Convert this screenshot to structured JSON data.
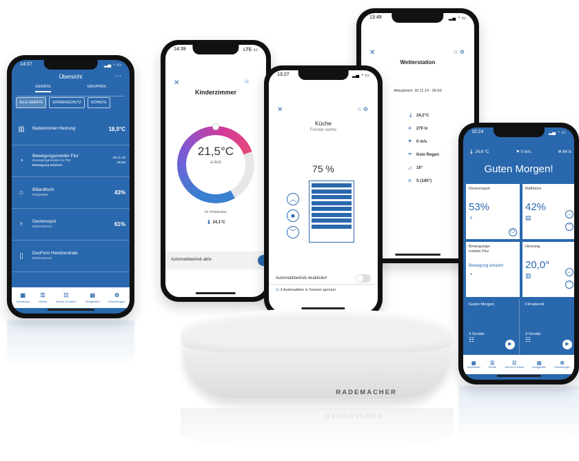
{
  "phone1": {
    "time": "14:07",
    "title": "Übersicht",
    "tabs": [
      "GERÄTE",
      "GRUPPEN"
    ],
    "filters": [
      "ALLE GERÄTE",
      "SONNENSCHUTZ",
      "SCHALTE"
    ],
    "rows": [
      {
        "name": "Badezimmer Heizung",
        "sub": "",
        "value": "18,5°C"
      },
      {
        "name": "Bewegungsmelder Flur",
        "sub": "Bewegungsmelder im Flur",
        "extra": "Bewegung erkannt",
        "value": "26.11.19\n06:56"
      },
      {
        "name": "Billardtisch",
        "sub": "Partykeller",
        "value": "43%"
      },
      {
        "name": "Deckenspot",
        "sub": "Wohnzimmer",
        "value": "61%"
      },
      {
        "name": "DuoFern Handzentrale",
        "sub": "Wohnzimmer",
        "value": ""
      }
    ],
    "nav": [
      "Dashboard",
      "Geräte",
      "Szenen & Autom",
      "Neuigkeiten",
      "Einstellungen"
    ]
  },
  "phone2": {
    "time": "14:39",
    "title": "Kinderzimmer",
    "temperature": "21,5°C",
    "mode": "AUS",
    "ist_label": "Ist-Temperatur",
    "ist_value": "24,1°C",
    "auto_label": "Automatikbetrieb aktiv"
  },
  "phone3": {
    "time": "13:27",
    "title": "Küche",
    "subtitle": "Fenster rechts",
    "percent": "75 %",
    "blind_position": 0.75,
    "auto_label": "Automatikbetrieb deaktiviert",
    "scene_label": "3 Automatiken in Szenen genutzt"
  },
  "phone4": {
    "time": "13:49",
    "title": "Wetterstation",
    "updated": "Aktualisiert: 26.11.19 - 06:59",
    "items": [
      "24,2°C",
      "270 lx",
      "0 m/s",
      "Kein Regen",
      "16°",
      "S (185°)"
    ]
  },
  "phone5": {
    "time": "10:24",
    "weather": [
      "24,6 °C",
      "0 m/s",
      "84 lx"
    ],
    "title": "Guten Morgen!",
    "tiles": [
      {
        "name": "Deckenspot",
        "value": "53%"
      },
      {
        "name": "Raffstore",
        "value": "42%"
      },
      {
        "name": "Bewegungs-\nmelder Flur",
        "value": "Bewegung erkannt"
      },
      {
        "name": "Heizung",
        "value": "20,0°"
      },
      {
        "name": "Guten Morgen",
        "value": "3 Geräte"
      },
      {
        "name": "Filmabend",
        "value": "3 Geräte"
      }
    ],
    "nav": [
      "Dashboard",
      "Geräte",
      "Szenen & Autom",
      "Neuigkeiten",
      "Einstellungen"
    ]
  },
  "hub": {
    "brand": "RADEMACHER"
  },
  "colors": {
    "brand_blue": "#2a68ad"
  }
}
